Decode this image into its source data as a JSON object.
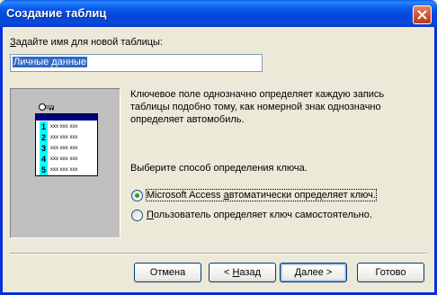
{
  "window": {
    "title": "Создание таблиц"
  },
  "form": {
    "name_label_hotkey": "З",
    "name_label_rest": "адайте имя для новой таблицы:",
    "name_value": "Личные данные"
  },
  "description": {
    "text": "Ключевое поле однозначно определяет каждую запись таблицы подобно тому, как номерной знак однозначно определяет автомобиль."
  },
  "illustration": {
    "rows": [
      {
        "num": "1",
        "cells": "xxx xxx xxx"
      },
      {
        "num": "2",
        "cells": "xxx xxx xxx"
      },
      {
        "num": "3",
        "cells": "xxx xxx xxx"
      },
      {
        "num": "4",
        "cells": "xxx xxx xxx"
      },
      {
        "num": "5",
        "cells": "xxx xxx xxx"
      }
    ]
  },
  "key_choice": {
    "prompt": "Выберите способ определения ключа.",
    "option_auto_pre": "Microsoft Access ",
    "option_auto_hotkey": "а",
    "option_auto_post": "втоматически определяет ключ.",
    "option_auto_checked": true,
    "option_user_hotkey": "П",
    "option_user_post": "ользователь определяет ключ самостоятельно.",
    "option_user_checked": false
  },
  "buttons": {
    "cancel": "Отмена",
    "back_pre": "< ",
    "back_hotkey": "Н",
    "back_post": "азад",
    "next_hotkey": "Д",
    "next_post": "алее >",
    "finish": "Готово"
  }
}
